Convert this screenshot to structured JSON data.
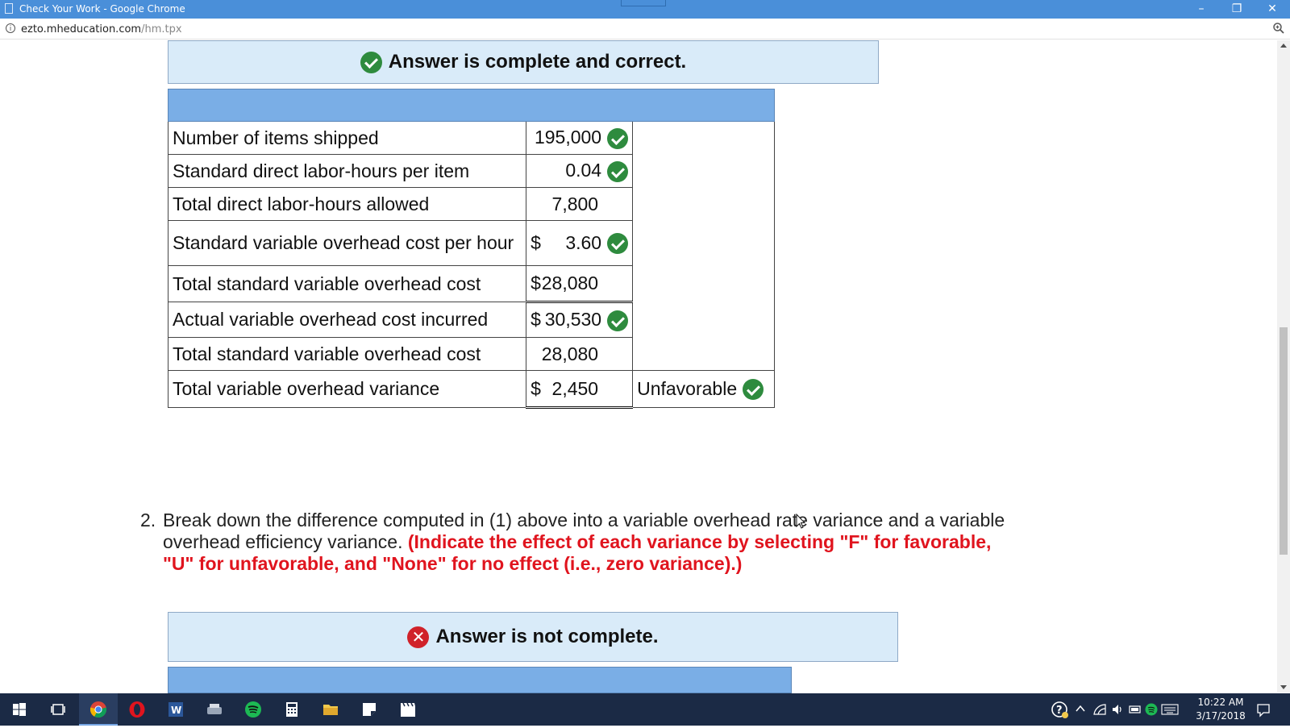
{
  "window": {
    "title": "Check Your Work - Google Chrome",
    "minimize": "–",
    "restore": "❐",
    "close": "✕"
  },
  "address": {
    "host": "ezto.mheducation.com",
    "path": "/hm.tpx"
  },
  "part1": {
    "banner": "Answer is complete and correct.",
    "rows": [
      {
        "label": "Number of items shipped",
        "value": "195,000"
      },
      {
        "label": "Standard direct labor-hours per item",
        "value": "0.04"
      },
      {
        "label": "Total direct labor-hours allowed",
        "value": "7,800"
      },
      {
        "label": "Standard variable overhead cost per hour",
        "currency": "$",
        "value": "3.60"
      },
      {
        "label": "Total standard variable overhead cost",
        "currency": "$",
        "value": "28,080"
      },
      {
        "label": "Actual variable overhead cost incurred",
        "currency": "$",
        "value": "30,530"
      },
      {
        "label": "Total standard variable overhead cost",
        "value": "28,080"
      },
      {
        "label": "Total variable overhead variance",
        "currency": "$",
        "value": "2,450",
        "effect": "Unfavorable"
      }
    ]
  },
  "part2": {
    "number": "2.",
    "text": "Break down the difference computed in (1) above into a variable overhead rate variance and a variable overhead efficiency variance.",
    "instruction": "(Indicate the effect of each variance by selecting \"F\" for favorable, \"U\" for unfavorable, and \"None\" for no effect (i.e., zero variance).)",
    "banner": "Answer is not complete."
  },
  "taskbar": {
    "apps": [
      "start-icon",
      "task-view-icon",
      "chrome-icon",
      "opera-icon",
      "word-icon",
      "scanner-icon",
      "spotify-icon",
      "calculator-icon",
      "file-explorer-icon",
      "sticky-notes-icon",
      "movies-icon"
    ],
    "time": "10:22 AM",
    "date": "3/17/2018"
  },
  "colors": {
    "titlebar": "#4a8fd9",
    "banner_bg": "#d9ebf9",
    "table_header": "#7aaee6",
    "check_green": "#2e8b3e",
    "error_red": "#d0222a",
    "instruction_red": "#e0141e",
    "taskbar": "#1b2a45"
  }
}
